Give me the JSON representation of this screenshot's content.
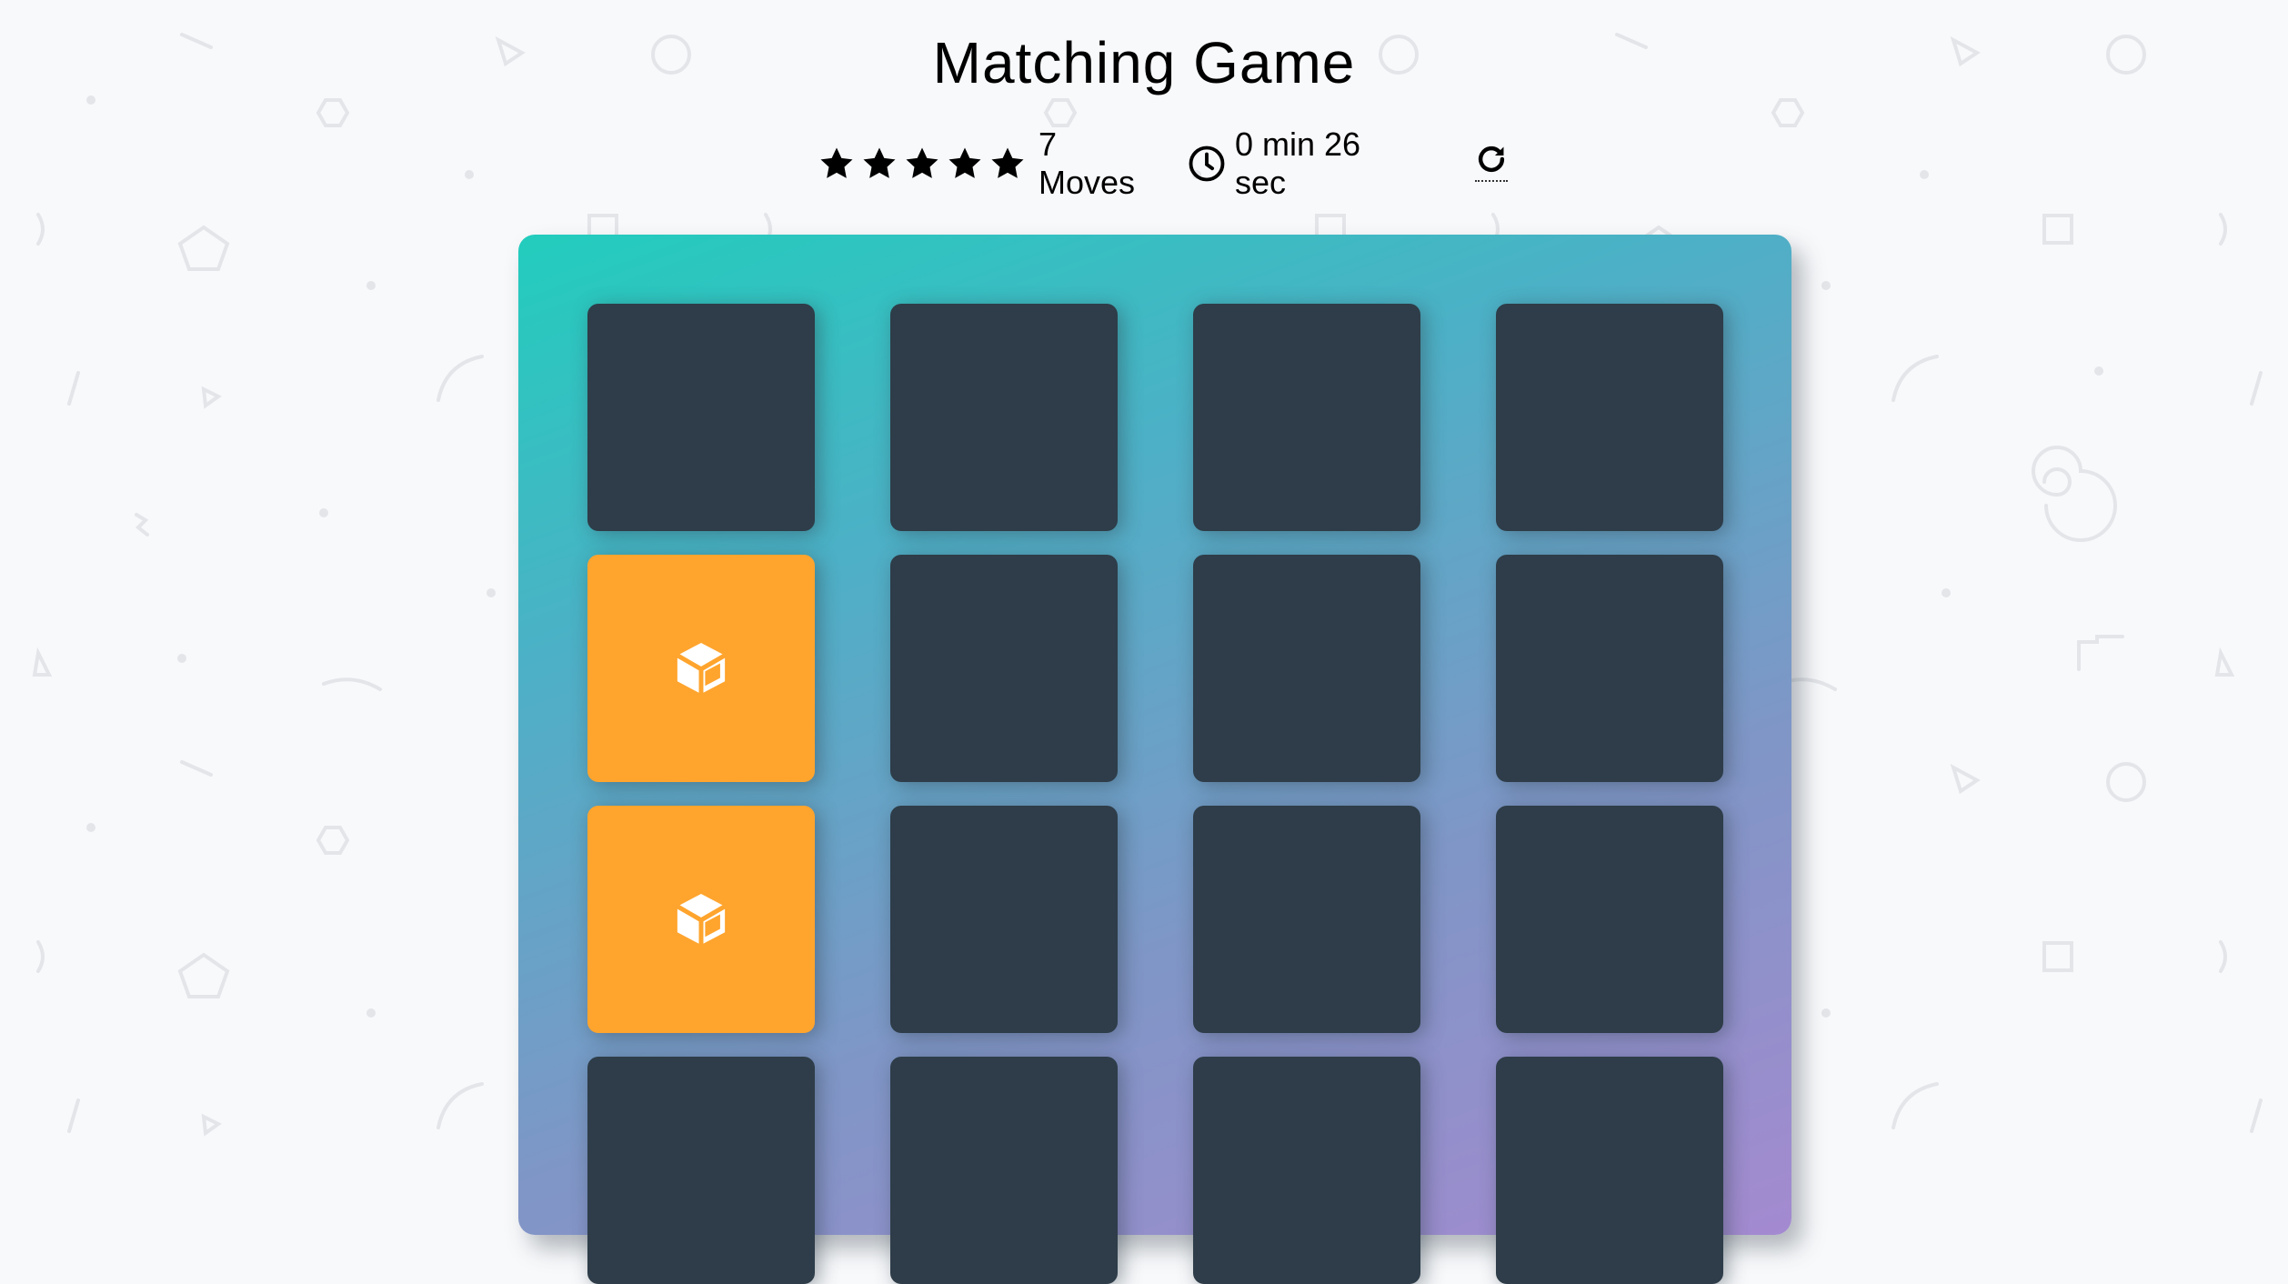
{
  "header": {
    "title": "Matching Game"
  },
  "score_panel": {
    "stars": 5,
    "moves_text": "7 Moves",
    "timer_text": "0 min 26 sec"
  },
  "deck": {
    "cards": [
      {
        "state": "closed",
        "icon": ""
      },
      {
        "state": "closed",
        "icon": ""
      },
      {
        "state": "closed",
        "icon": ""
      },
      {
        "state": "closed",
        "icon": ""
      },
      {
        "state": "open",
        "icon": "cube-icon"
      },
      {
        "state": "closed",
        "icon": ""
      },
      {
        "state": "closed",
        "icon": ""
      },
      {
        "state": "closed",
        "icon": ""
      },
      {
        "state": "open",
        "icon": "cube-icon"
      },
      {
        "state": "closed",
        "icon": ""
      },
      {
        "state": "closed",
        "icon": ""
      },
      {
        "state": "closed",
        "icon": ""
      },
      {
        "state": "closed",
        "icon": ""
      },
      {
        "state": "closed",
        "icon": ""
      },
      {
        "state": "closed",
        "icon": ""
      },
      {
        "state": "closed",
        "icon": ""
      }
    ]
  },
  "colors": {
    "card_back": "#2e3d49",
    "card_open": "#ffa42d",
    "deck_gradient_start": "#22cdbd",
    "deck_gradient_end": "#a48ad0"
  },
  "icons": {
    "star": "star-icon",
    "clock": "clock-icon",
    "restart": "restart-icon"
  }
}
